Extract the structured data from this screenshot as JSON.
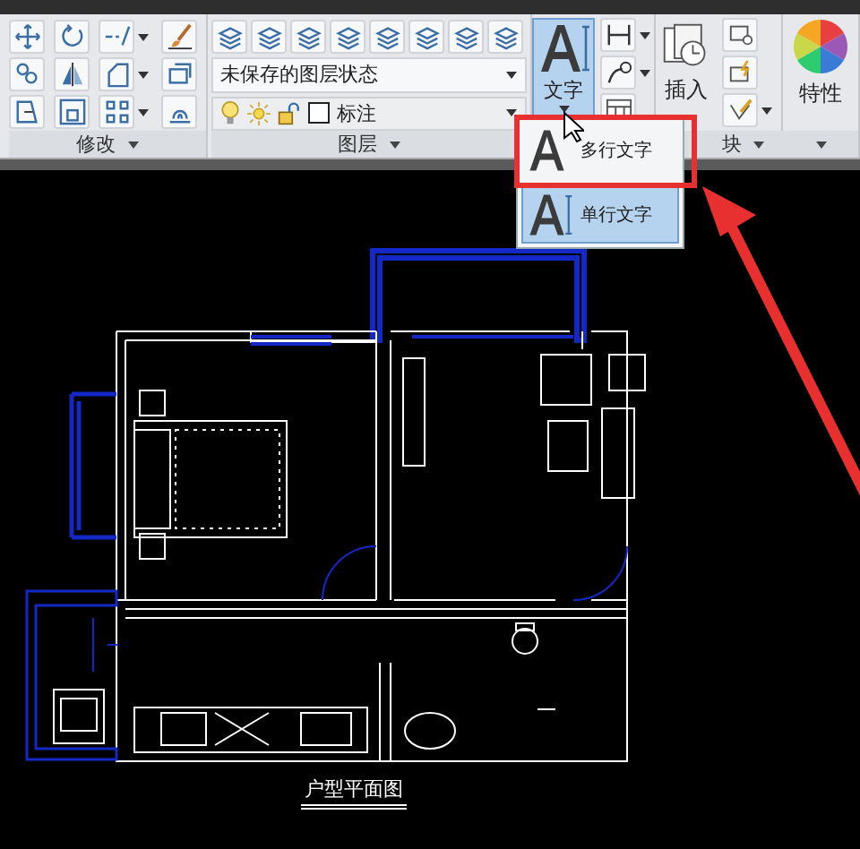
{
  "modify_panel": {
    "title": "修改"
  },
  "layer_panel": {
    "title": "图层",
    "layer_state": "未保存的图层状态",
    "current_layer": "标注"
  },
  "text_button": {
    "label": "文字",
    "pressed": true
  },
  "text_menu": {
    "items": [
      {
        "label": "多行文字",
        "selected": false
      },
      {
        "label": "单行文字",
        "selected": true
      }
    ]
  },
  "block_panel": {
    "title": "块",
    "insert_label": "插入"
  },
  "properties_button": {
    "label": "特性"
  },
  "drawing": {
    "caption": "户型平面图"
  }
}
